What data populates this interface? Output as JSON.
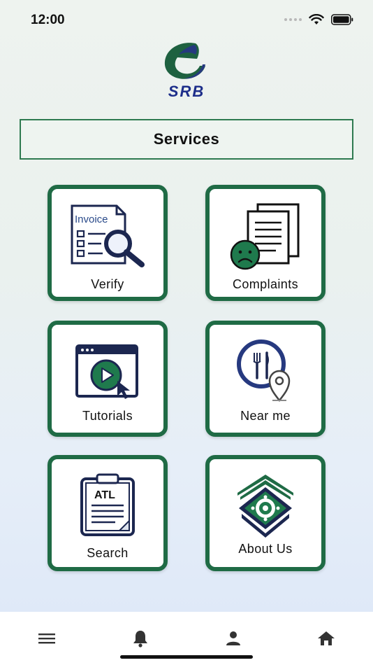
{
  "status_bar": {
    "time": "12:00"
  },
  "logo": {
    "text": "SRB"
  },
  "header": {
    "title": "Services"
  },
  "tiles": [
    {
      "label": "Verify",
      "icon": "invoice-search-icon",
      "icon_text": "Invoice"
    },
    {
      "label": "Complaints",
      "icon": "complaint-documents-icon"
    },
    {
      "label": "Tutorials",
      "icon": "video-tutorial-icon"
    },
    {
      "label": "Near me",
      "icon": "restaurant-location-icon"
    },
    {
      "label": "Search",
      "icon": "atl-clipboard-icon",
      "icon_text": "ATL"
    },
    {
      "label": "About Us",
      "icon": "emblem-icon"
    }
  ],
  "bottom_nav": [
    {
      "icon": "menu-icon"
    },
    {
      "icon": "bell-icon"
    },
    {
      "icon": "user-icon"
    },
    {
      "icon": "home-icon"
    }
  ],
  "colors": {
    "accent": "#1f6b45",
    "brand_blue": "#1d2e8a",
    "icon_navy": "#1c2750"
  }
}
